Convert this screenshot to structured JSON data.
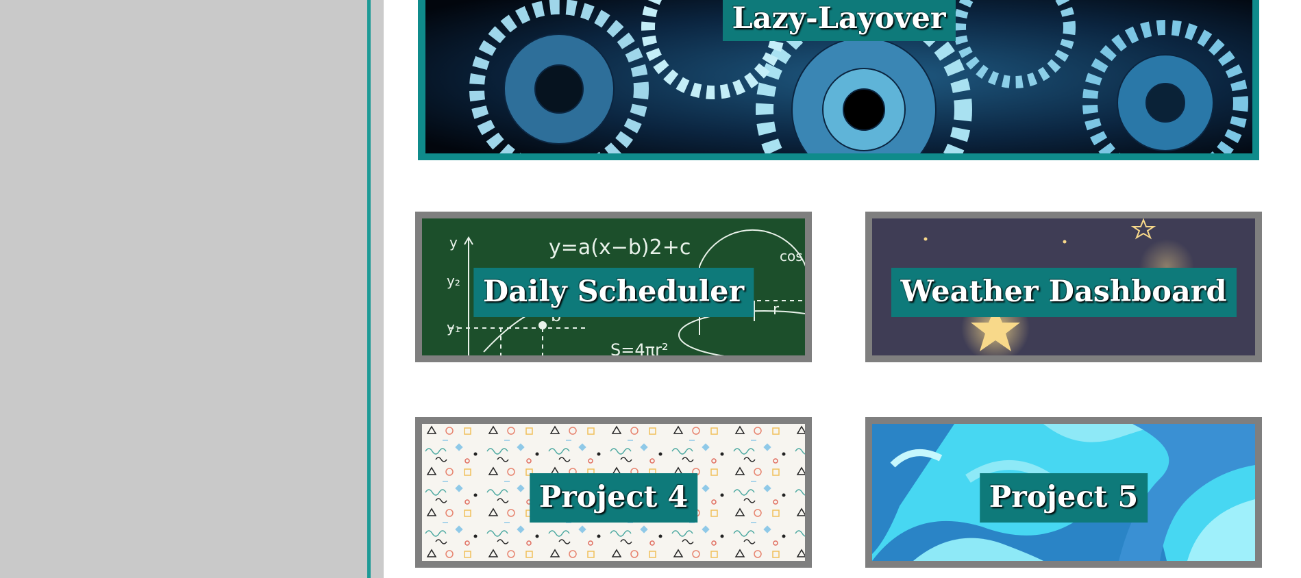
{
  "colors": {
    "sidebar_bg": "#c9c9c9",
    "accent_teal": "#1d9a96",
    "label_bg": "#0e7a7a",
    "tile_border": "#7f7f7f",
    "page_bg": "#ffffff"
  },
  "featured_project": {
    "title": "Lazy-Layover",
    "image_icon": "gears-image"
  },
  "projects": [
    {
      "title": "Daily Scheduler",
      "image_icon": "chalkboard-math-image"
    },
    {
      "title": "Weather Dashboard",
      "image_icon": "night-sky-stars-image"
    },
    {
      "title": "Project 4",
      "image_icon": "doodle-pattern-image"
    },
    {
      "title": "Project 5",
      "image_icon": "blue-waves-image"
    }
  ],
  "chalkboard_text": {
    "equation": "y=a(x−b)2+c",
    "axis_y": "y",
    "y2": "y₂",
    "y1": "y₁",
    "point_b": "b",
    "cos": "cos",
    "r": "r",
    "formula": "S=4πr²"
  }
}
